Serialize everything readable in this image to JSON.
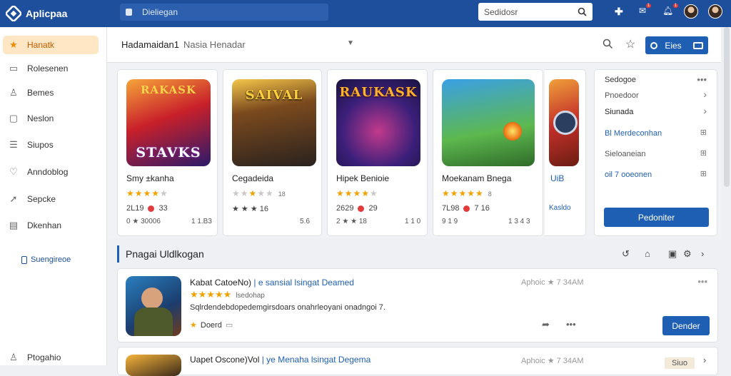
{
  "app": {
    "name": "Aplicpaa",
    "crumb": "Dieliegan"
  },
  "search": {
    "placeholder": "Sedidosr"
  },
  "colors": {
    "primary": "#1e5fb3",
    "topbar": "#1e4f9c",
    "accent": "#f08a00",
    "star": "#f2a200"
  },
  "topbar_icons": {
    "plus": "plus-icon",
    "notif_a": "1",
    "notif_b": "1"
  },
  "sidebar": {
    "items": [
      {
        "label": "Hanatk",
        "icon": "star-icon"
      },
      {
        "label": "Rolesenen",
        "icon": "document-icon"
      },
      {
        "label": "Bemes",
        "icon": "user-icon"
      },
      {
        "label": "Neslon",
        "icon": "chat-icon"
      },
      {
        "label": "Siupos",
        "icon": "list-icon"
      },
      {
        "label": "Anndoblog",
        "icon": "shield-icon"
      },
      {
        "label": "Sepcke",
        "icon": "send-icon"
      },
      {
        "label": "Dkenhan",
        "icon": "calendar-icon"
      }
    ],
    "sub_link": "Suengireoe",
    "footer": "Ptogahio"
  },
  "main_header": {
    "title": "Hadamaidan1",
    "subtitle": "Nasia Henadar",
    "button_label": "Eies"
  },
  "games": [
    {
      "art_text": "STAVKS",
      "art_top": "RAKASK",
      "name": "Smy ±kanha",
      "rating": 5,
      "rating_num": "",
      "meta": "2L19",
      "meta_b": "33",
      "meta2": "0 ★ 30006",
      "meta3": "1 1.B3"
    },
    {
      "art_text": "SAIVAL",
      "art_top": "",
      "name": "Cegadeida",
      "rating": 2,
      "rating_num": "18",
      "meta": "★ ★ ★ 16",
      "meta_b": "",
      "meta2": "",
      "meta3": "5.6"
    },
    {
      "art_text": "RAUKASK",
      "art_top": "",
      "name": "Hipek Benioie",
      "rating": 5,
      "rating_num": "",
      "meta": "2629",
      "meta_b": "29",
      "meta2": "2 ★ ★ 18",
      "meta3": "1 1 0"
    },
    {
      "art_text": "",
      "art_top": "",
      "name": "Moekanam Bnega",
      "rating": 5,
      "rating_num": "8",
      "meta": "7L98",
      "meta_b": "7 16",
      "meta2": "9 1 9",
      "meta3": "1 3 4 3"
    },
    {
      "art_text": "",
      "art_top": "",
      "name": "UiB",
      "rating": 0,
      "rating_num": "",
      "meta": "Kasldo",
      "meta_b": "",
      "meta2": "",
      "meta3": ""
    }
  ],
  "right_panel": {
    "title": "Sedogoe",
    "rows": [
      {
        "label": "Pnoedoor",
        "end": "›"
      },
      {
        "label": "Siunada",
        "end": "›"
      },
      {
        "label": "Bl Merdeconhan",
        "end": "⊞"
      },
      {
        "label": "Sieloaneian",
        "end": "⊞"
      },
      {
        "label": "oil 7 ooeonen",
        "end": "⊞"
      }
    ],
    "button": "Pedoniter"
  },
  "section": {
    "title": "Pnagai Uldlkogan"
  },
  "list": [
    {
      "title": "Kabat CatoeNo)",
      "tags": "| e sansial lsingat Deamed",
      "stars": 5,
      "sub": "lsedohap",
      "desc": "Sqlrdendebdopedemgirsdoars onahrleoyani onadngoi 7.",
      "fav": "Doerd",
      "time": "Aphoic ★ 7 34AM",
      "button": "Dender"
    },
    {
      "title": "Uapet Oscone)Vol",
      "tags": "| ye Menaha lsingat Degema",
      "stars": 0,
      "sub": "",
      "desc": "",
      "fav": "",
      "time": "Aphoic ★ 7 34AM",
      "button": "Siuo"
    }
  ]
}
